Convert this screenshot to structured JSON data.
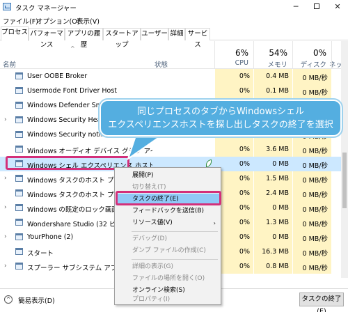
{
  "window": {
    "title": "タスク マネージャー",
    "min": "─",
    "close": "✕"
  },
  "menu": [
    "ファイル(F)",
    "オプション(O)",
    "表示(V)"
  ],
  "tabs": [
    "プロセス",
    "パフォーマンス",
    "アプリの履歴",
    "スタートアップ",
    "ユーザー",
    "詳細",
    "サービス"
  ],
  "header": {
    "sort_arrow": "^",
    "name": "名前",
    "status": "状態",
    "cpu_pct": "6%",
    "cpu_label": "CPU",
    "mem_pct": "54%",
    "mem_label": "メモリ",
    "disk_pct": "0%",
    "disk_label": "ディスク",
    "net_label": "ネッ"
  },
  "rows": [
    {
      "expand": "",
      "name": "User OOBE Broker",
      "cpu": "0%",
      "mem": "0.4 MB",
      "disk": "0 MB/秒"
    },
    {
      "expand": "",
      "name": "Usermode Font Driver Host",
      "cpu": "0%",
      "mem": "0.1 MB",
      "disk": "0 MB/秒"
    },
    {
      "expand": "",
      "name": "Windows Defender SmartScreen",
      "cpu": "0%",
      "mem": "",
      "disk": "0 MB/秒"
    },
    {
      "expand": "›",
      "name": "Windows Security Health Service",
      "cpu": "",
      "mem": "",
      "disk": "0 MB/秒"
    },
    {
      "expand": "",
      "name": "Windows Security notification icon",
      "cpu": "",
      "mem": "",
      "disk": "0 MB/秒"
    },
    {
      "expand": "",
      "name": "Windows オーディオ デバイス グラフ アイソレーション",
      "cpu": "0%",
      "mem": "3.6 MB",
      "disk": "0 MB/秒"
    },
    {
      "expand": "",
      "name": "Windows シェル エクスペリエンス ホスト",
      "cpu": "0%",
      "mem": "0 MB",
      "disk": "0 MB/秒"
    },
    {
      "expand": "›",
      "name": "Windows タスクのホスト プロセス",
      "cpu": "0%",
      "mem": "1.5 MB",
      "disk": "0 MB/秒"
    },
    {
      "expand": "",
      "name": "Windows タスクのホスト プロセス",
      "cpu": "0%",
      "mem": "2.4 MB",
      "disk": "0 MB/秒"
    },
    {
      "expand": "›",
      "name": "Windows の既定のロック画面",
      "cpu": "0%",
      "mem": "0 MB",
      "disk": "0 MB/秒"
    },
    {
      "expand": "",
      "name": "Wondershare Studio (32 ビット)",
      "cpu": "0%",
      "mem": "1.3 MB",
      "disk": "0 MB/秒"
    },
    {
      "expand": "›",
      "name": "YourPhone (2)",
      "cpu": "0%",
      "mem": "0 MB",
      "disk": "0 MB/秒"
    },
    {
      "expand": "",
      "name": "スタート",
      "cpu": "0%",
      "mem": "16.3 MB",
      "disk": "0 MB/秒"
    },
    {
      "expand": "›",
      "name": "スプーラー サブシステム アプリケーション",
      "cpu": "0%",
      "mem": "0.8 MB",
      "disk": "0 MB/秒"
    }
  ],
  "context_menu": {
    "expand": "展開(P)",
    "switch_to": "切り替え(T)",
    "end_task": "タスクの終了(E)",
    "feedback": "フィードバックを送信(B)",
    "resource_values": "リソース値(V)",
    "debug": "デバッグ(D)",
    "dump": "ダンプ ファイルの作成(C)",
    "details": "詳細の表示(G)",
    "open_location": "ファイルの場所を開く(O)",
    "search_online": "オンライン検索(S)",
    "properties": "プロパティ(I)",
    "sub_arrow": "›"
  },
  "bottom": {
    "fewer_details": "簡易表示(D)",
    "toggle_glyph": "^",
    "end_task_button": "タスクの終了(E)"
  },
  "callout": {
    "line1": "同じプロセスのタブからWindowsシェル",
    "line2": "エクスペリエンスホストを探し出しタスクの終了を選択"
  },
  "colors": {
    "accent_highlight": "#d3307a",
    "callout_bg": "#54aee0",
    "selected_row": "#cce8ff",
    "heat_cell": "#fff4c4"
  }
}
